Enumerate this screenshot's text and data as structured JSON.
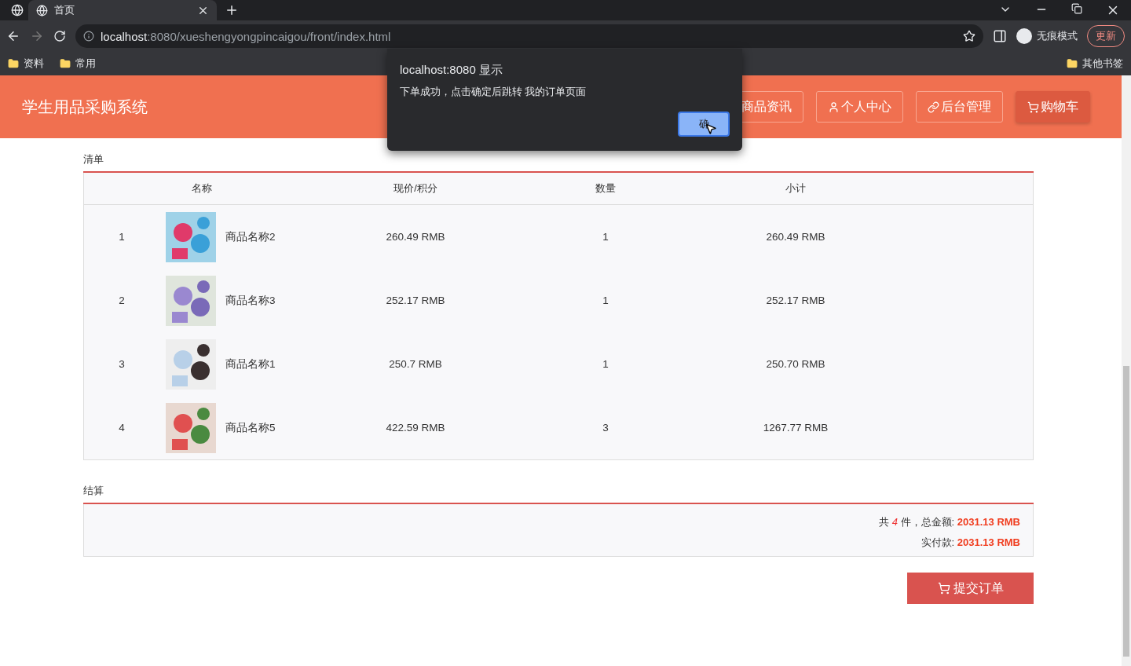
{
  "browser": {
    "tabs": [
      {
        "title": "首页",
        "selected": true
      }
    ],
    "url_host": "localhost",
    "url_rest": ":8080/xueshengyongpincaigou/front/index.html",
    "incognito_label": "无痕模式",
    "update_label": "更新",
    "bookmarks": [
      "资料",
      "常用"
    ],
    "other_bookmarks": "其他书签"
  },
  "header": {
    "title": "学生用品采购系统",
    "nav": [
      {
        "label": "商品资讯",
        "kind": "plain",
        "selected": false
      },
      {
        "label": "个人中心",
        "kind": "user",
        "selected": false
      },
      {
        "label": "后台管理",
        "kind": "link",
        "selected": false
      },
      {
        "label": "购物车",
        "kind": "cart",
        "selected": true
      }
    ]
  },
  "list_title": "清单",
  "table": {
    "columns": [
      "名称",
      "现价/积分",
      "数量",
      "小计"
    ],
    "rows": [
      {
        "index": "1",
        "name": "商品名称2",
        "price": "260.49 RMB",
        "qty": "1",
        "subtotal": "260.49 RMB"
      },
      {
        "index": "2",
        "name": "商品名称3",
        "price": "252.17 RMB",
        "qty": "1",
        "subtotal": "252.17 RMB"
      },
      {
        "index": "3",
        "name": "商品名称1",
        "price": "250.7 RMB",
        "qty": "1",
        "subtotal": "250.70 RMB"
      },
      {
        "index": "4",
        "name": "商品名称5",
        "price": "422.59 RMB",
        "qty": "3",
        "subtotal": "1267.77 RMB"
      }
    ]
  },
  "settle_title": "结算",
  "summary": [
    "共 *4* 件，总金额: **2031.13 RMB**",
    "实付款: **2031.13 RMB**"
  ],
  "submit": "提交订单",
  "dialog": {
    "title": "localhost:8080 显示",
    "message": "下单成功，点击确定后跳转 我的订单页面",
    "ok": "确"
  }
}
